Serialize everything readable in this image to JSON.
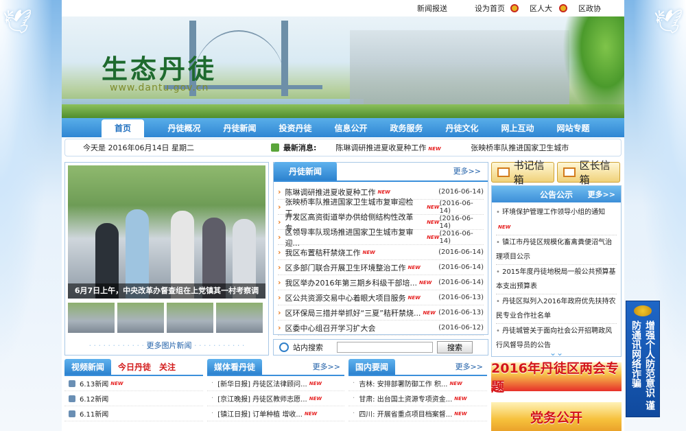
{
  "topbar": {
    "links": [
      "新闻报送",
      "设为首页",
      "区人大",
      "区政协"
    ]
  },
  "banner": {
    "title": "生态丹徒",
    "url": "www.dantu.gov.cn"
  },
  "nav": [
    "首页",
    "丹徒概况",
    "丹徒新闻",
    "投资丹徒",
    "信息公开",
    "政务服务",
    "丹徒文化",
    "网上互动",
    "网站专题"
  ],
  "datebar": {
    "date": "今天是 2016年06月14日 星期二",
    "ann_label": "最新消息:",
    "marquee": [
      "陈琳调研推进夏收夏种工作",
      "张映桥率队推进国家卫生城市"
    ]
  },
  "photo": {
    "caption": "6月7日上午，中央改革办督查组在上党镇其一村考察调",
    "more": "更多图片新闻"
  },
  "news": {
    "title": "丹徒新闻",
    "more": "更多>>",
    "items": [
      {
        "t": "陈琳调研推进夏收夏种工作",
        "d": "(2016-06-14)"
      },
      {
        "t": "张映桥率队推进国家卫生城市复审迎检工...",
        "d": "(2016-06-14)"
      },
      {
        "t": "开发区高资街道举办供给侧结构性改革专...",
        "d": "(2016-06-14)"
      },
      {
        "t": "区领导率队现场推进国家卫生城市复审迎...",
        "d": "(2016-06-14)"
      },
      {
        "t": "我区布置秸秆禁烧工作",
        "d": "(2016-06-14)"
      },
      {
        "t": "区多部门联合开展卫生环境整治工作",
        "d": "(2016-06-14)"
      },
      {
        "t": "我区举办2016年第三期乡科级干部培...",
        "d": "(2016-06-14)"
      },
      {
        "t": "区公共资源交易中心着眼大项目服务",
        "d": "(2016-06-13)"
      },
      {
        "t": "区环保局三措并举抓好“三夏”秸秆禁烧...",
        "d": "(2016-06-13)"
      },
      {
        "t": "区委中心组召开学习扩大会",
        "d": "(2016-06-12)"
      }
    ]
  },
  "search": {
    "label": "站内搜索",
    "button": "搜索",
    "value": ""
  },
  "mailboxes": {
    "secretary": "书记信箱",
    "mayor": "区长信箱"
  },
  "notice": {
    "title": "公告公示",
    "more": "更多>>",
    "items": [
      "环境保护管理工作领导小组的通知",
      "镇江市丹徒区规模化畜禽粪便沼气治理项目公示",
      "2015年度丹徒地税局一般公共预算基本支出预算表",
      "丹徒区拟列入2016年政府优先扶持农民专业合作社名单",
      "丹徒城管关于面向社会公开招聘政风行风督导员的公告"
    ]
  },
  "ads": {
    "two_sessions": "2016年丹徒区两会专题",
    "party": "党务公开"
  },
  "video": {
    "tabs": [
      "视频新闻",
      "今日丹徒",
      "关注"
    ],
    "items": [
      "6.13新闻",
      "6.12新闻",
      "6.11新闻"
    ]
  },
  "media": {
    "title": "媒体看丹徒",
    "more": "更多>>",
    "items": [
      "[新华日报] 丹徒区法律顾问...",
      "[京江晚报] 丹徒区教师志愿...",
      "[镇江日报] 订单种植 增收..."
    ]
  },
  "domestic": {
    "title": "国内要闻",
    "more": "更多>>",
    "items": [
      "吉林: 安排部署防御工作 积...",
      "甘肃: 出台国土资源专项资金...",
      "四川: 开展省重点项目档案督..."
    ]
  },
  "police": {
    "text": "增强个人防范意识 谨防通讯网络诈骗"
  },
  "colors": {
    "nav_blue": "#2f86d3",
    "accent_red": "#e62020"
  }
}
